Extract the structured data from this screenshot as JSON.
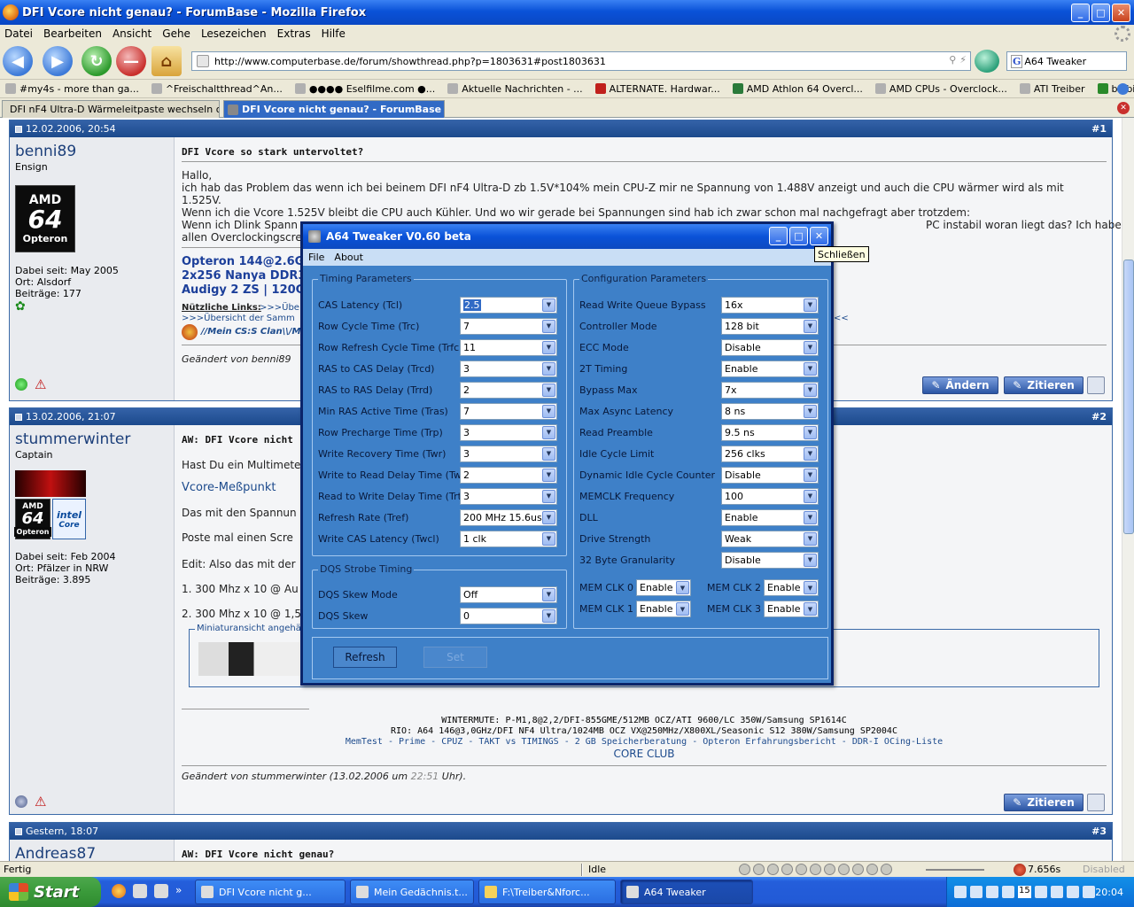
{
  "window": {
    "title": "DFI Vcore nicht genau? - ForumBase - Mozilla Firefox",
    "controls": {
      "minimize": "_",
      "maximize": "□",
      "close": "✕"
    }
  },
  "menu": [
    "Datei",
    "Bearbeiten",
    "Ansicht",
    "Gehe",
    "Lesezeichen",
    "Extras",
    "Hilfe"
  ],
  "nav": {
    "url": "http://www.computerbase.de/forum/showthread.php?p=1803631#post1803631",
    "search_value": "A64 Tweaker",
    "search_engine": "G"
  },
  "bookmarks": [
    "#my4s - more than ga...",
    "^Freischaltthread^An...",
    "●●●● Eselfilme.com ●...",
    "Aktuelle Nachrichten - ...",
    "ALTERNATE. Hardwar...",
    "AMD Athlon 64 Overcl...",
    "AMD CPUs - Overclock...",
    "ATI Treiber",
    "blabiz.tk"
  ],
  "tabs": [
    "DFI nF4 Ultra-D Wärmeleitpaste wechseln o...",
    "DFI Vcore nicht genau? - ForumBase"
  ],
  "posts": [
    {
      "date": "12.02.2006, 20:54",
      "num": "#1",
      "user": "benni89",
      "rank": "Ensign",
      "since": "Dabei seit: May 2005",
      "location": "Ort: Alsdorf",
      "posts": "Beiträge: 177",
      "title": "DFI Vcore so stark untervoltet?",
      "lines": [
        "Hallo,",
        "ich hab das Problem das wenn ich bei beinem DFI nF4 Ultra-D zb 1.5V*104% mein CPU-Z mir ne Spannung von 1.488V anzeigt und auch die CPU wärmer wird als mit",
        "1.525V.",
        "Wenn ich die Vcore 1.525V bleibt die CPU auch Kühler. Und wo wir gerade bei Spannungen sind hab ich zwar schon mal nachgefragt aber trotzdem:",
        "Wenn ich Dlink Spann",
        "allen Overclockingscre"
      ],
      "line4_right": "PC instabil woran liegt das? Ich habe bis jetzt bei",
      "sig": [
        "Opteron 144@2.6GH",
        "2x256 Nanya DDR33",
        "Audigy 2 ZS | 120GB"
      ],
      "useful_label": "Nützliche Links:",
      "useful_1": ">>>Übe",
      "useful_2": ">>>Übersicht der Samm",
      "useful_3": "//Mein CS:S Clan\\\\/M",
      "useful_tail": "<<",
      "edited": "Geändert von benni89",
      "btn_edit": "Ändern",
      "btn_quote": "Zitieren",
      "logo": {
        "brand": "AMD",
        "model": "64",
        "line": "Opteron"
      }
    },
    {
      "date": "13.02.2006, 21:07",
      "num": "#2",
      "user": "stummerwinter",
      "rank": "Captain",
      "since": "Dabei seit: Feb 2004",
      "location": "Ort: Pfälzer in NRW",
      "posts": "Beiträge: 3.895",
      "title": "AW: DFI Vcore nicht",
      "lines": [
        "Hast Du ein Multimete",
        "Vcore-Meßpunkt",
        "Das mit den Spannun",
        "Poste mal einen Scre",
        "Edit: Also das mit der",
        "1. 300 Mhz x 10 @ Au",
        "2. 300 Mhz x 10 @ 1,5"
      ],
      "thumb_label": "Miniaturansicht angehän",
      "sig1": "WINTERMUTE: P-M1,8@2,2/DFI-855GME/512MB OCZ/ATI 9600/LC 350W/Samsung SP1614C",
      "sig2": "RIO: A64 146@3,0GHz/DFI NF4 Ultra/1024MB OCZ VX@250MHz/X800XL/Seasonic S12 380W/Samsung SP2004C",
      "sig3": [
        "MemTest",
        "Prime",
        "CPUZ",
        "TAKT vs TIMINGS",
        "2 GB Speicherberatung",
        "Opteron Erfahrungsbericht",
        "DDR-I OCing-Liste"
      ],
      "sig_sep": " - ",
      "sig4": "CORE CLUB",
      "edited_prefix": "Geändert von stummerwinter (13.02.2006 um ",
      "edited_time": "22:51",
      "edited_suffix": " Uhr).",
      "btn_quote": "Zitieren",
      "logo": {
        "brand": "AMD",
        "model": "64",
        "line": "Opteron",
        "intel": "intel",
        "intel_sub": "Core"
      }
    },
    {
      "date": "Gestern, 18:07",
      "num": "#3",
      "user": "Andreas87",
      "title": "AW: DFI Vcore nicht genau?"
    }
  ],
  "tweaker": {
    "title": "A64 Tweaker V0.60 beta",
    "menu": [
      "File",
      "About"
    ],
    "tooltip": "Schließen",
    "timing_group": "Timing Parameters",
    "timing": [
      {
        "label": "CAS Latency (Tcl)",
        "value": "2.5"
      },
      {
        "label": "Row Cycle Time (Trc)",
        "value": "7"
      },
      {
        "label": "Row Refresh Cycle Time (Trfc)",
        "value": "11"
      },
      {
        "label": "RAS to CAS Delay (Trcd)",
        "value": "3"
      },
      {
        "label": "RAS to RAS Delay (Trrd)",
        "value": "2"
      },
      {
        "label": "Min RAS Active Time (Tras)",
        "value": "7"
      },
      {
        "label": "Row Precharge Time (Trp)",
        "value": "3"
      },
      {
        "label": "Write Recovery Time (Twr)",
        "value": "3"
      },
      {
        "label": "Write to Read Delay Time (Twtr)",
        "value": "2"
      },
      {
        "label": "Read to Write Delay Time (Trtw)",
        "value": "3"
      },
      {
        "label": "Refresh Rate (Tref)",
        "value": "200 MHz 15.6us"
      },
      {
        "label": "Write CAS Latency (Twcl)",
        "value": "1 clk"
      }
    ],
    "dqs_group": "DQS Strobe Timing",
    "dqs": [
      {
        "label": "DQS Skew Mode",
        "value": "Off"
      },
      {
        "label": "DQS Skew",
        "value": "0"
      }
    ],
    "config_group": "Configuration Parameters",
    "config": [
      {
        "label": "Read Write Queue Bypass",
        "value": "16x"
      },
      {
        "label": "Controller Mode",
        "value": "128 bit"
      },
      {
        "label": "ECC Mode",
        "value": "Disable"
      },
      {
        "label": "2T Timing",
        "value": "Enable"
      },
      {
        "label": "Bypass Max",
        "value": "7x"
      },
      {
        "label": "Max Async Latency",
        "value": "8 ns"
      },
      {
        "label": "Read Preamble",
        "value": "9.5 ns"
      },
      {
        "label": "Idle Cycle Limit",
        "value": "256 clks"
      },
      {
        "label": "Dynamic Idle Cycle Counter",
        "value": "Disable"
      },
      {
        "label": "MEMCLK Frequency",
        "value": "100"
      },
      {
        "label": "DLL",
        "value": "Enable"
      },
      {
        "label": "Drive Strength",
        "value": "Weak"
      },
      {
        "label": "32 Byte Granularity",
        "value": "Disable"
      }
    ],
    "memclk": [
      {
        "label": "MEM CLK 0",
        "value": "Enable"
      },
      {
        "label": "MEM CLK 2",
        "value": "Enable"
      },
      {
        "label": "MEM CLK 1",
        "value": "Enable"
      },
      {
        "label": "MEM CLK 3",
        "value": "Enable"
      }
    ],
    "refresh": "Refresh",
    "set": "Set"
  },
  "status": {
    "left": "Fertig",
    "middle": "Idle",
    "time": "7.656s",
    "right": "Disabled"
  },
  "taskbar": {
    "start": "Start",
    "quick_more": "»",
    "tasks": [
      "DFI Vcore nicht g...",
      "Mein Gedächnis.t...",
      "F:\\Treiber&Nforc...",
      "A64 Tweaker"
    ],
    "tray_badge": "15",
    "clock": "20:04"
  },
  "colors": {
    "accent": "#316ac5",
    "dialog_bg": "#3e80c8",
    "post_header": "#1c4a8c"
  }
}
